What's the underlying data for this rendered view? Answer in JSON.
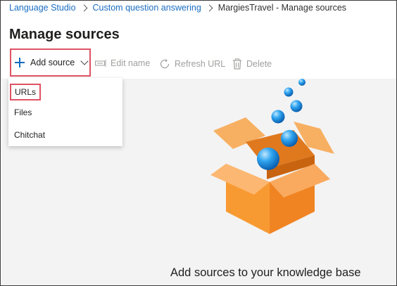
{
  "breadcrumb": {
    "items": [
      "Language Studio",
      "Custom question answering",
      "MargiesTravel - Manage sources"
    ]
  },
  "page": {
    "title": "Manage sources"
  },
  "toolbar": {
    "add_source": "Add source",
    "edit_name": "Edit name",
    "refresh_url": "Refresh URL",
    "delete": "Delete"
  },
  "dropdown": {
    "items": [
      "URLs",
      "Files",
      "Chitchat"
    ]
  },
  "empty_state": {
    "message": "Add sources to your knowledge base"
  },
  "colors": {
    "accent": "#0f6cbd",
    "link": "#1b6ec2",
    "highlight_border": "#e05263",
    "box_orange": "#f7a24b",
    "bubble_blue": "#1e90e0"
  },
  "icons": [
    "plus-icon",
    "chevron-down-icon",
    "edit-name-icon",
    "refresh-icon",
    "trash-icon",
    "open-box-icon",
    "bubble-icon"
  ]
}
